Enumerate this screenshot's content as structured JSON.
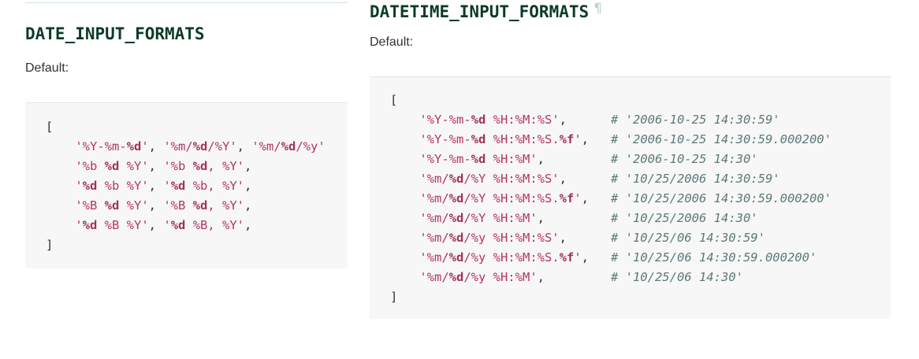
{
  "date_section": {
    "heading": "DATE_INPUT_FORMATS",
    "default_label": "Default:",
    "code_lines": [
      [
        {
          "t": "[",
          "k": "p"
        }
      ],
      [
        {
          "t": "    ",
          "k": "p"
        },
        {
          "t": "'%Y-%m-",
          "k": "s"
        },
        {
          "t": "%d",
          "k": "b"
        },
        {
          "t": "'",
          "k": "s"
        },
        {
          "t": ", ",
          "k": "p"
        },
        {
          "t": "'%m/",
          "k": "s"
        },
        {
          "t": "%d",
          "k": "b"
        },
        {
          "t": "/%Y'",
          "k": "s"
        },
        {
          "t": ", ",
          "k": "p"
        },
        {
          "t": "'%m/",
          "k": "s"
        },
        {
          "t": "%d",
          "k": "b"
        },
        {
          "t": "/%y'",
          "k": "s"
        }
      ],
      [
        {
          "t": "    ",
          "k": "p"
        },
        {
          "t": "'%b ",
          "k": "s"
        },
        {
          "t": "%d",
          "k": "b"
        },
        {
          "t": " %Y'",
          "k": "s"
        },
        {
          "t": ", ",
          "k": "p"
        },
        {
          "t": "'%b ",
          "k": "s"
        },
        {
          "t": "%d",
          "k": "b"
        },
        {
          "t": ", %Y'",
          "k": "s"
        },
        {
          "t": ",",
          "k": "p"
        }
      ],
      [
        {
          "t": "    ",
          "k": "p"
        },
        {
          "t": "'",
          "k": "s"
        },
        {
          "t": "%d",
          "k": "b"
        },
        {
          "t": " %b %Y'",
          "k": "s"
        },
        {
          "t": ", ",
          "k": "p"
        },
        {
          "t": "'",
          "k": "s"
        },
        {
          "t": "%d",
          "k": "b"
        },
        {
          "t": " %b, %Y'",
          "k": "s"
        },
        {
          "t": ",",
          "k": "p"
        }
      ],
      [
        {
          "t": "    ",
          "k": "p"
        },
        {
          "t": "'%B ",
          "k": "s"
        },
        {
          "t": "%d",
          "k": "b"
        },
        {
          "t": " %Y'",
          "k": "s"
        },
        {
          "t": ", ",
          "k": "p"
        },
        {
          "t": "'%B ",
          "k": "s"
        },
        {
          "t": "%d",
          "k": "b"
        },
        {
          "t": ", %Y'",
          "k": "s"
        },
        {
          "t": ",",
          "k": "p"
        }
      ],
      [
        {
          "t": "    ",
          "k": "p"
        },
        {
          "t": "'",
          "k": "s"
        },
        {
          "t": "%d",
          "k": "b"
        },
        {
          "t": " %B %Y'",
          "k": "s"
        },
        {
          "t": ", ",
          "k": "p"
        },
        {
          "t": "'",
          "k": "s"
        },
        {
          "t": "%d",
          "k": "b"
        },
        {
          "t": " %B, %Y'",
          "k": "s"
        },
        {
          "t": ",",
          "k": "p"
        }
      ],
      [
        {
          "t": "]",
          "k": "p"
        }
      ]
    ]
  },
  "datetime_section": {
    "heading": "DATETIME_INPUT_FORMATS",
    "anchor_symbol": "¶",
    "default_label": "Default:",
    "code_lines": [
      [
        {
          "t": "[",
          "k": "p"
        }
      ],
      [
        {
          "t": "    ",
          "k": "p"
        },
        {
          "t": "'%Y-%m-",
          "k": "s"
        },
        {
          "t": "%d",
          "k": "b"
        },
        {
          "t": " %H:%M:%S'",
          "k": "s"
        },
        {
          "t": ",      ",
          "k": "p"
        },
        {
          "t": "# '2006-10-25 14:30:59'",
          "k": "c"
        }
      ],
      [
        {
          "t": "    ",
          "k": "p"
        },
        {
          "t": "'%Y-%m-",
          "k": "s"
        },
        {
          "t": "%d",
          "k": "b"
        },
        {
          "t": " %H:%M:%S.",
          "k": "s"
        },
        {
          "t": "%f",
          "k": "b"
        },
        {
          "t": "'",
          "k": "s"
        },
        {
          "t": ",   ",
          "k": "p"
        },
        {
          "t": "# '2006-10-25 14:30:59.000200'",
          "k": "c"
        }
      ],
      [
        {
          "t": "    ",
          "k": "p"
        },
        {
          "t": "'%Y-%m-",
          "k": "s"
        },
        {
          "t": "%d",
          "k": "b"
        },
        {
          "t": " %H:%M'",
          "k": "s"
        },
        {
          "t": ",         ",
          "k": "p"
        },
        {
          "t": "# '2006-10-25 14:30'",
          "k": "c"
        }
      ],
      [
        {
          "t": "    ",
          "k": "p"
        },
        {
          "t": "'%m/",
          "k": "s"
        },
        {
          "t": "%d",
          "k": "b"
        },
        {
          "t": "/%Y %H:%M:%S'",
          "k": "s"
        },
        {
          "t": ",      ",
          "k": "p"
        },
        {
          "t": "# '10/25/2006 14:30:59'",
          "k": "c"
        }
      ],
      [
        {
          "t": "    ",
          "k": "p"
        },
        {
          "t": "'%m/",
          "k": "s"
        },
        {
          "t": "%d",
          "k": "b"
        },
        {
          "t": "/%Y %H:%M:%S.",
          "k": "s"
        },
        {
          "t": "%f",
          "k": "b"
        },
        {
          "t": "'",
          "k": "s"
        },
        {
          "t": ",   ",
          "k": "p"
        },
        {
          "t": "# '10/25/2006 14:30:59.000200'",
          "k": "c"
        }
      ],
      [
        {
          "t": "    ",
          "k": "p"
        },
        {
          "t": "'%m/",
          "k": "s"
        },
        {
          "t": "%d",
          "k": "b"
        },
        {
          "t": "/%Y %H:%M'",
          "k": "s"
        },
        {
          "t": ",         ",
          "k": "p"
        },
        {
          "t": "# '10/25/2006 14:30'",
          "k": "c"
        }
      ],
      [
        {
          "t": "    ",
          "k": "p"
        },
        {
          "t": "'%m/",
          "k": "s"
        },
        {
          "t": "%d",
          "k": "b"
        },
        {
          "t": "/%y %H:%M:%S'",
          "k": "s"
        },
        {
          "t": ",      ",
          "k": "p"
        },
        {
          "t": "# '10/25/06 14:30:59'",
          "k": "c"
        }
      ],
      [
        {
          "t": "    ",
          "k": "p"
        },
        {
          "t": "'%m/",
          "k": "s"
        },
        {
          "t": "%d",
          "k": "b"
        },
        {
          "t": "/%y %H:%M:%S.",
          "k": "s"
        },
        {
          "t": "%f",
          "k": "b"
        },
        {
          "t": "'",
          "k": "s"
        },
        {
          "t": ",   ",
          "k": "p"
        },
        {
          "t": "# '10/25/06 14:30:59.000200'",
          "k": "c"
        }
      ],
      [
        {
          "t": "    ",
          "k": "p"
        },
        {
          "t": "'%m/",
          "k": "s"
        },
        {
          "t": "%d",
          "k": "b"
        },
        {
          "t": "/%y %H:%M'",
          "k": "s"
        },
        {
          "t": ",         ",
          "k": "p"
        },
        {
          "t": "# '10/25/06 14:30'",
          "k": "c"
        }
      ],
      [
        {
          "t": "]",
          "k": "p"
        }
      ]
    ]
  }
}
